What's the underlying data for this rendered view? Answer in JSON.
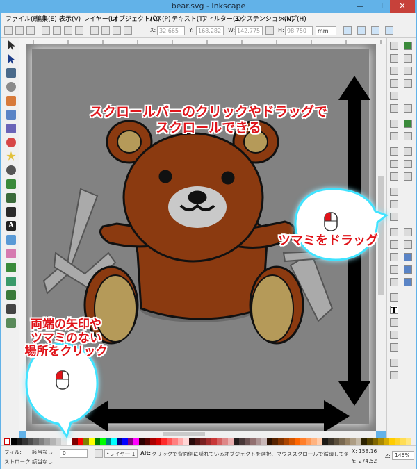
{
  "window": {
    "title": "bear.svg - Inkscape",
    "min_glyph": "—",
    "max_glyph": "☐",
    "close_glyph": "✕"
  },
  "menu": [
    "ファイル(F)",
    "編集(E)",
    "表示(V)",
    "レイヤー(L)",
    "オブジェクト(O)",
    "パス(P)",
    "テキスト(T)",
    "フィルター(S)",
    "エクステンション(N)",
    "ヘルプ(H)"
  ],
  "toolbar": {
    "x_label": "X:",
    "x_value": "32.665",
    "y_label": "Y:",
    "y_value": "168.282",
    "w_label": "W:",
    "w_value": "142.775",
    "h_label": "H:",
    "h_value": "98.750",
    "unit": "mm"
  },
  "annotations": {
    "scrollbar_line1": "スクロールバーのクリックやドラッグで",
    "scrollbar_line2": "スクロールできる",
    "drag_thumb": "ツマミをドラッグ",
    "click_line1": "両端の矢印や",
    "click_line2": "ツマミのない",
    "click_line3": "場所をクリック"
  },
  "statusbar": {
    "fill_label": "フィル:",
    "fill_value": "該当なし",
    "stroke_label": "ストローク:",
    "stroke_value": "該当なし",
    "opacity_value": "0",
    "layer_value": "•レイヤー 1",
    "message_prefix": "Alt:",
    "message": "クリックで背面側に隠れているオブジェクトを選択、マウススクロールで循環して選択、ドラッグで選…",
    "x_label": "X:",
    "x_value": "158.16",
    "y_label": "Y:",
    "y_value": "274.52",
    "zoom_label": "Z:",
    "zoom_value": "146%"
  },
  "colors": {
    "bear_brown": "#8b3a10",
    "bear_ear": "#b59a59",
    "bear_muzzle": "#c9c9c9",
    "annotation_red": "#e0141a",
    "bubble_glow": "#3fe3ff",
    "title_blue": "#62b2e8"
  }
}
